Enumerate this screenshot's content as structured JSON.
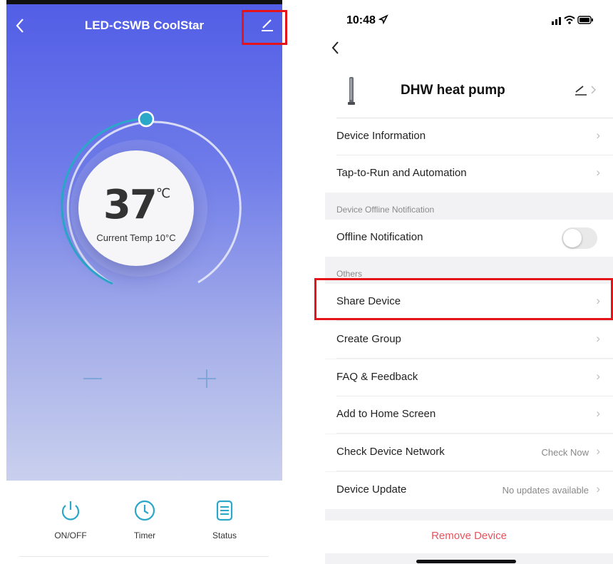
{
  "left_screen": {
    "title": "LED-CSWB CoolStar",
    "dial": {
      "set_temp": "37",
      "unit": "℃",
      "current_label": "Current Temp 10°C"
    },
    "controls": [
      {
        "label": "ON/OFF",
        "icon": "power-icon"
      },
      {
        "label": "Timer",
        "icon": "clock-icon"
      },
      {
        "label": "Status",
        "icon": "document-icon"
      }
    ],
    "colors": {
      "gradient_top": "#525ee6",
      "gradient_bottom": "#c9d0ee",
      "accent": "#2aa7c9"
    }
  },
  "right_screen": {
    "status_bar": {
      "time": "10:48"
    },
    "device": {
      "name": "DHW heat pump"
    },
    "rows_group1": [
      {
        "label": "Device Information"
      },
      {
        "label": "Tap-to-Run and Automation"
      }
    ],
    "section_offline": "Device Offline Notification",
    "offline_row": {
      "label": "Offline Notification",
      "enabled": false
    },
    "section_others": "Others",
    "rows_others": [
      {
        "label": "Share Device",
        "value": ""
      },
      {
        "label": "Create Group",
        "value": ""
      },
      {
        "label": "FAQ & Feedback",
        "value": ""
      },
      {
        "label": "Add to Home Screen",
        "value": ""
      },
      {
        "label": "Check Device Network",
        "value": "Check Now"
      },
      {
        "label": "Device Update",
        "value": "No updates available"
      }
    ],
    "remove_label": "Remove Device",
    "colors": {
      "remove": "#e8525c",
      "highlight": "#e5141b"
    }
  }
}
